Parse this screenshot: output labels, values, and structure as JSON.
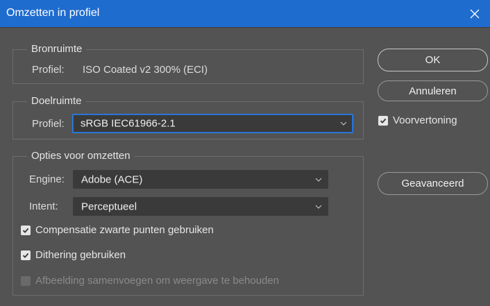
{
  "window": {
    "title": "Omzetten in profiel"
  },
  "source_space": {
    "legend": "Bronruimte",
    "profile_label": "Profiel:",
    "profile_value": "ISO Coated v2 300% (ECI)"
  },
  "destination_space": {
    "legend": "Doelruimte",
    "profile_label": "Profiel:",
    "profile_selected": "sRGB IEC61966-2.1"
  },
  "conversion_options": {
    "legend": "Opties voor omzetten",
    "engine_label": "Engine:",
    "engine_selected": "Adobe (ACE)",
    "intent_label": "Intent:",
    "intent_selected": "Perceptueel",
    "black_point_label": "Compensatie zwarte punten gebruiken",
    "black_point_checked": true,
    "dither_label": "Dithering gebruiken",
    "dither_checked": true,
    "flatten_label": "Afbeelding samenvoegen om weergave te behouden",
    "flatten_checked": false,
    "flatten_enabled": false
  },
  "buttons": {
    "ok": "OK",
    "cancel": "Annuleren",
    "advanced": "Geavanceerd"
  },
  "preview": {
    "label": "Voorvertoning",
    "checked": true
  },
  "colors": {
    "titlebar": "#1f6ccf",
    "dialog_bg": "#535353",
    "select_bg": "#3a3a3a",
    "focus_ring": "#2d7fe0"
  }
}
